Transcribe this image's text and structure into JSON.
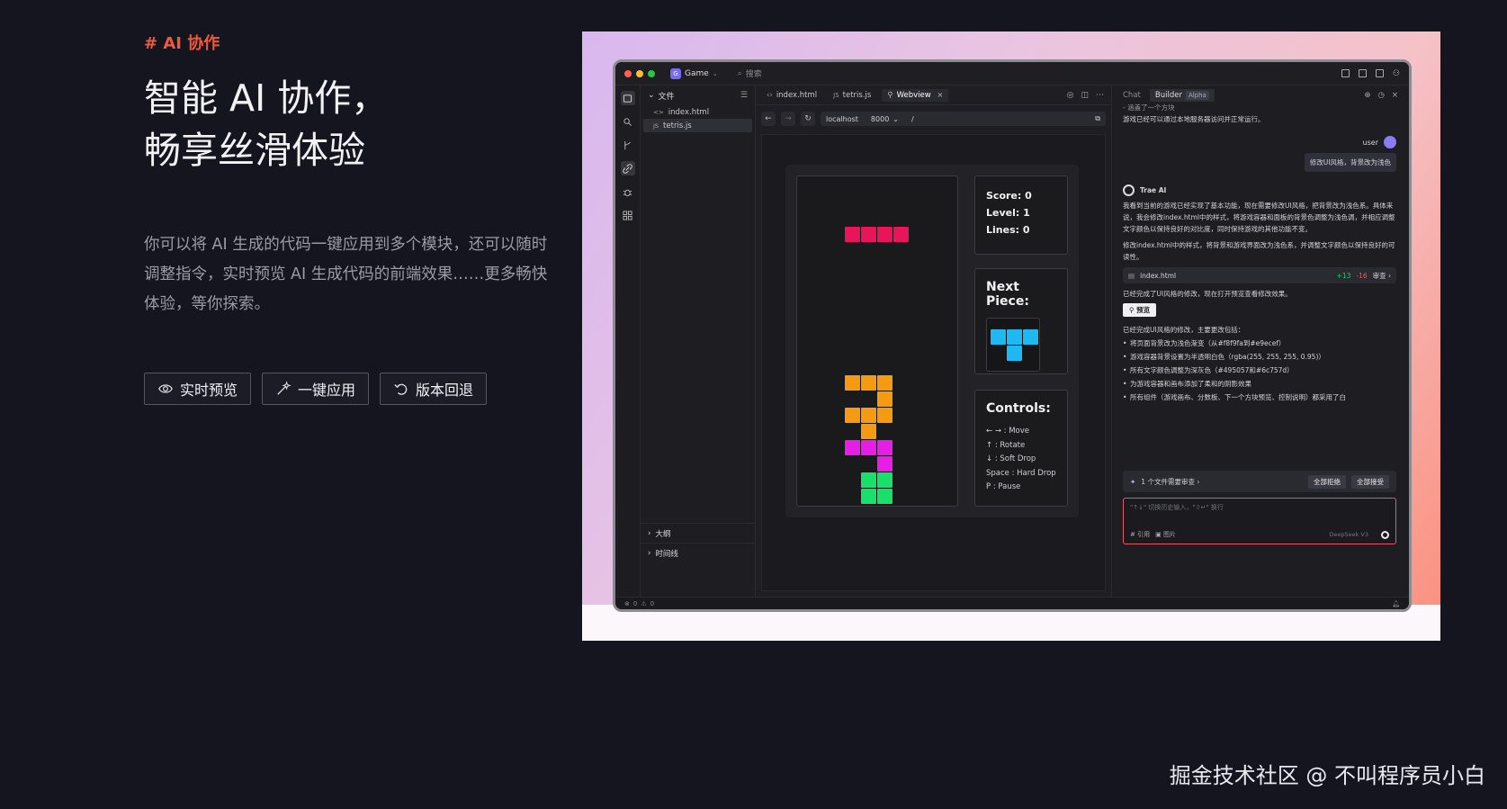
{
  "promo": {
    "tag": "# AI 协作",
    "headline_line1": "智能 AI 协作，",
    "headline_line2": "畅享丝滑体验",
    "description": "你可以将 AI 生成的代码一键应用到多个模块，还可以随时调整指令，实时预览 AI 生成代码的前端效果……更多畅快体验，等你探索。",
    "buttons": [
      {
        "label": "实时预览",
        "icon": "eye-icon"
      },
      {
        "label": "一键应用",
        "icon": "magic-wand-icon"
      },
      {
        "label": "版本回退",
        "icon": "undo-icon"
      }
    ]
  },
  "watermark": "掘金技术社区 @ 不叫程序员小白",
  "ide": {
    "project": {
      "logo": "G",
      "name": "Game"
    },
    "search_placeholder": "搜索",
    "explorer": {
      "title": "文件",
      "files": [
        {
          "name": "index.html",
          "icon": "<>"
        },
        {
          "name": "tetris.js",
          "icon": "JS"
        }
      ],
      "outline": "大纲",
      "timeline": "时间线"
    },
    "tabs": [
      {
        "label": "index.html"
      },
      {
        "label": "tetris.js"
      },
      {
        "label": "Webview",
        "close": "×"
      }
    ],
    "url": {
      "host": "localhost",
      "port": "8000",
      "path": "/"
    },
    "status": {
      "errors": "0",
      "warnings": "0"
    }
  },
  "game": {
    "score_label": "Score: 0",
    "level_label": "Level: 1",
    "lines_label": "Lines: 0",
    "next_piece_title": "Next Piece:",
    "controls_title": "Controls:",
    "controls": [
      "← → : Move",
      "↑ : Rotate",
      "↓ : Soft Drop",
      "Space : Hard Drop",
      "P : Pause"
    ],
    "colors": {
      "I_piece": "#e8155a",
      "orange": "#f59a12",
      "magenta": "#e61ee6",
      "green": "#19e06a",
      "cyan": "#1fb8f0"
    }
  },
  "chat": {
    "tabs": {
      "chat": "Chat",
      "builder": "Builder",
      "alpha": "Alpha"
    },
    "intro_line1": "- 涵盖了一个方块",
    "intro_line2": "游戏已经可以通过本地服务器访问并正常运行。",
    "user_name": "user",
    "user_message": "修改UI风格，背景改为浅色",
    "ai_name": "Trae AI",
    "ai_para1": "我看到当前的游戏已经实现了基本功能，现在需要修改UI风格，把背景改为浅色系。具体来说，我会修改index.html中的样式，将游戏容器和面板的背景色调整为浅色调，并相应调整文字颜色以保持良好的对比度，同时保持游戏的其他功能不变。",
    "ai_para2": "修改index.html中的样式，将背景和游戏界面改为浅色系，并调整文字颜色以保持良好的可读性。",
    "file_card": {
      "name": "index.html",
      "plus": "+13",
      "minus": "-16",
      "action": "审查 ›"
    },
    "ai_para3": "已经完成了UI风格的修改，现在打开预览查看修改效果。",
    "preview_label": "预览",
    "ai_para4": "已经完成UI风格的修改，主要更改包括：",
    "bullets": [
      "将页面背景改为浅色渐变（从#f8f9fa到#e9ecef）",
      "游戏容器背景设置为半透明白色（rgba(255, 255, 255, 0.95)）",
      "所有文字颜色调整为深灰色（#495057和#6c757d）",
      "为游戏容器和画布添加了柔和的阴影效果",
      "所有组件（游戏画布、分数板、下一个方块预览、控制说明）都采用了白"
    ],
    "review_text": "1 个文件需要审查 ›",
    "reject_all": "全部拒绝",
    "accept_all": "全部接受",
    "input_placeholder": "\"↑↓\" 切换历史输入，\"⇧↵\" 换行",
    "input_ref": "# 引用",
    "input_image": "图片",
    "model": "DeepSeek V3"
  }
}
